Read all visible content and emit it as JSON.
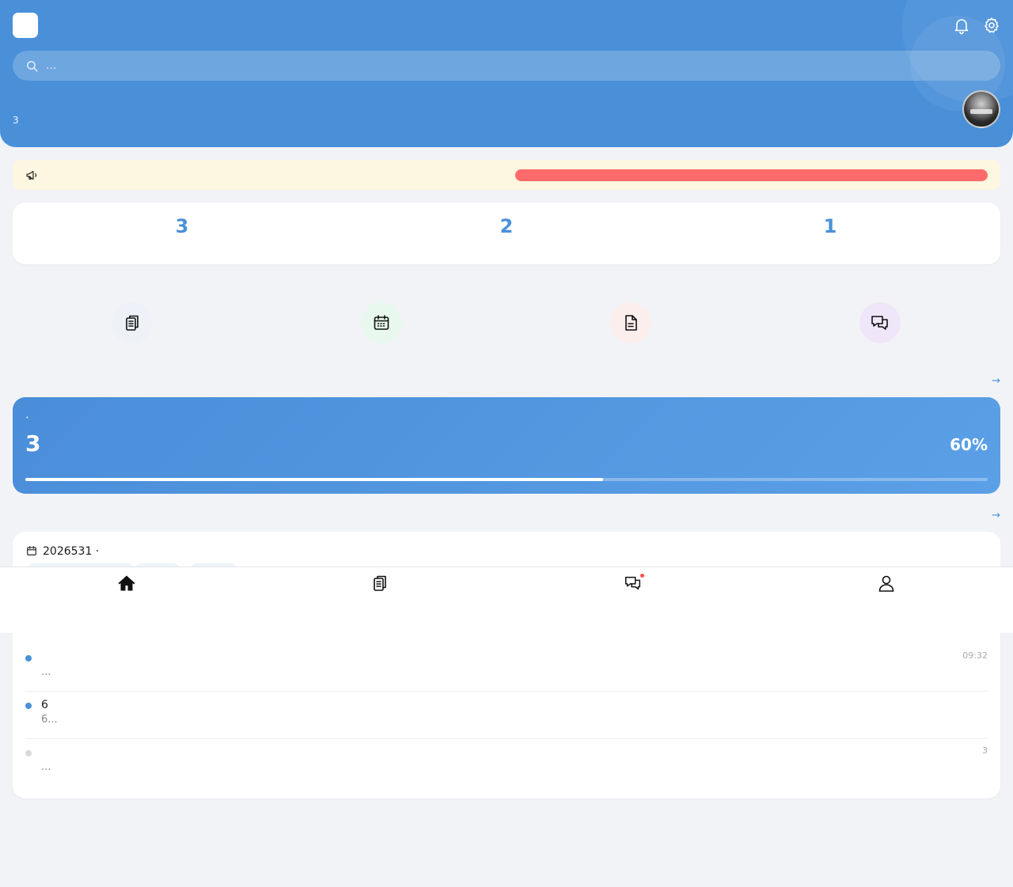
{
  "app": {
    "logo_glyph": "",
    "title": ""
  },
  "header": {
    "bg_color": "#4a90d9",
    "icons": [
      "bell-icon",
      "gear-icon"
    ],
    "search": {
      "placeholder": "...",
      "value": ""
    },
    "greeting": " ",
    "subtitle": " 3 "
  },
  "notice": {
    "icon": "megaphone-icon",
    "text": " ",
    "bar_label": "",
    "bar_color": "#ff6b6b"
  },
  "stats": [
    {
      "value": "3",
      "label": ""
    },
    {
      "value": "2",
      "label": ""
    },
    {
      "value": "1",
      "label": ""
    }
  ],
  "quick_actions": {
    "title": "",
    "items": [
      {
        "icon": "clipboard-icon",
        "label": "",
        "bg": "#eef2f8"
      },
      {
        "icon": "calendar-icon",
        "label": "",
        "bg": "#e8f8ee"
      },
      {
        "icon": "document-icon",
        "label": "",
        "bg": "#fdeeee"
      },
      {
        "icon": "chat-icon",
        "label": "",
        "bg": "#f0e6fa"
      }
    ]
  },
  "current_course": {
    "section_title": "",
    "more_link": " →",
    "title": "  · ",
    "count": "3",
    "count_label": "",
    "percent_label": "60%",
    "percent_caption": "",
    "progress": 0.6
  },
  "schedule": {
    "section_title": "",
    "more_link": " →",
    "date": "2026531 · "
  },
  "notifications": [
    {
      "title": "",
      "desc": "...",
      "time": "09:32",
      "unread": true
    },
    {
      "title": "6",
      "desc": "6...",
      "time": "",
      "unread": true
    },
    {
      "title": "",
      "desc": "...",
      "time": "3",
      "unread": false
    }
  ],
  "tabbar": [
    {
      "icon": "home-icon",
      "label": "",
      "active": true
    },
    {
      "icon": "clipboard-icon",
      "label": "",
      "active": false
    },
    {
      "icon": "chat-icon",
      "label": "",
      "active": false,
      "badge": true
    },
    {
      "icon": "user-icon",
      "label": "",
      "active": false
    }
  ],
  "colors": {
    "accent": "#4a90d9",
    "page_bg": "#f2f3f7",
    "notice_bg": "#fdf6e0",
    "notice_text": "#b8860b",
    "badge": "#ff4d4f"
  }
}
